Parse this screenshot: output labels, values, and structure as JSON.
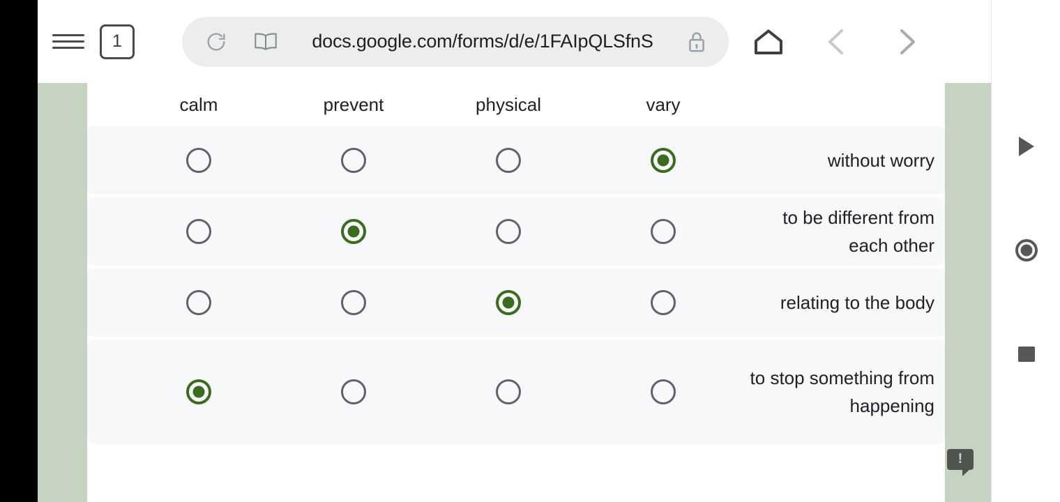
{
  "browser": {
    "menu_icon": "hamburger-menu-icon",
    "tab_count": "1",
    "reload_icon": "reload-icon",
    "reader_icon": "book-reader-icon",
    "url": "docs.google.com/forms/d/e/1FAIpQLSfnS",
    "lock_icon": "lock-icon",
    "home_icon": "home-icon",
    "back_icon": "chevron-left-icon",
    "forward_icon": "chevron-right-icon"
  },
  "grid": {
    "columns": [
      "calm",
      "prevent",
      "physical",
      "vary"
    ],
    "rows": [
      {
        "label": "without worry",
        "selected": 3
      },
      {
        "label": "to be different from each other",
        "selected": 1
      },
      {
        "label": "relating to the body",
        "selected": 2
      },
      {
        "label": "to stop something from happening",
        "selected": 0
      }
    ]
  },
  "controls": {
    "play": "play-icon",
    "record": "record-icon",
    "stop": "stop-icon"
  },
  "warning": {
    "glyph": "!"
  },
  "colors": {
    "page_band": "#c6d3c0",
    "selected_radio": "#3a6b1e",
    "unselected_radio": "#5f6368",
    "row_background": "#f7f8fa"
  }
}
